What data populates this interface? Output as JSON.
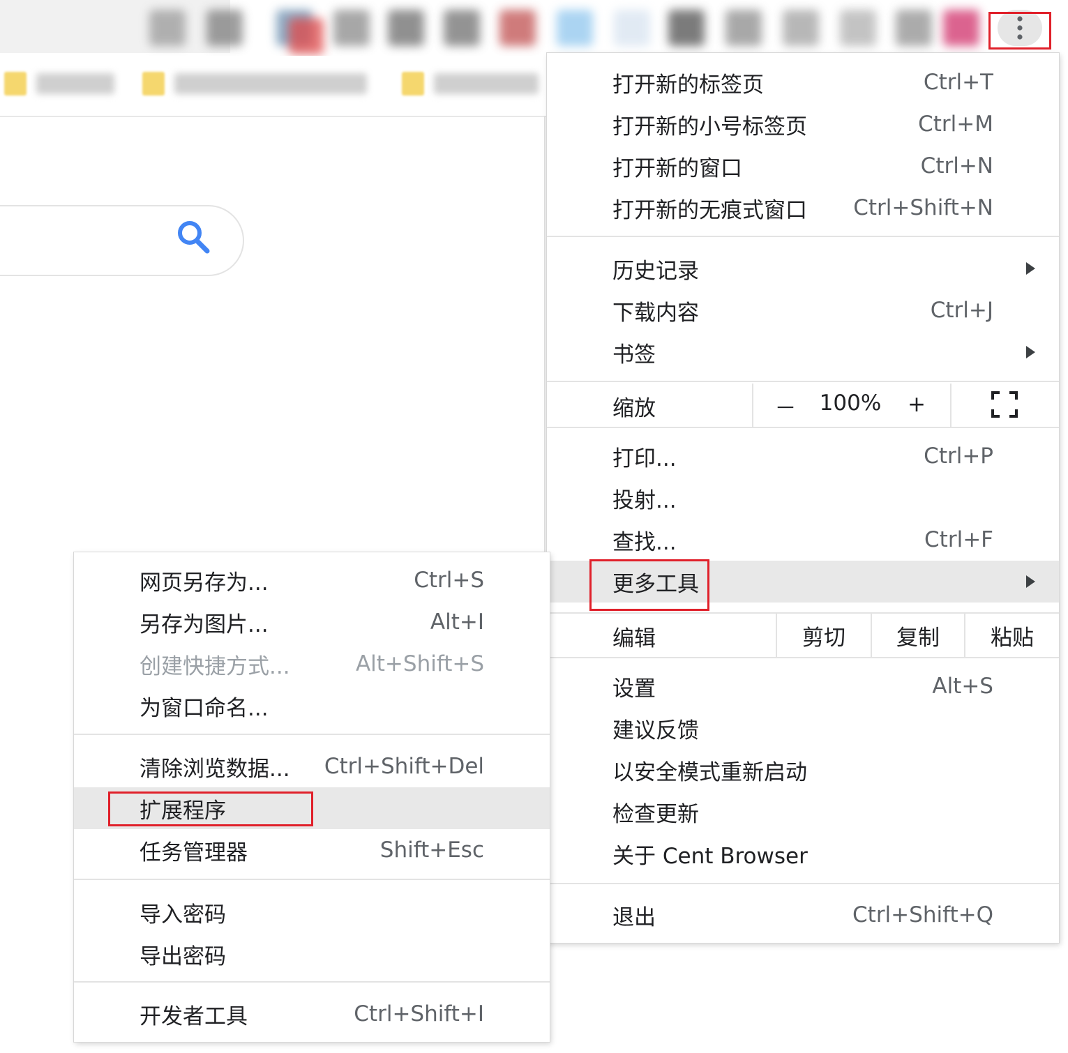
{
  "colors": {
    "highlight": "#e0202a",
    "menu_bg": "#ffffff",
    "selected_bg": "#e8e8e8",
    "search_icon": "#4285f4"
  },
  "toolbar": {
    "menu_icon": "three-dots-vertical-icon"
  },
  "search": {
    "icon": "search-icon"
  },
  "main_menu": {
    "new_tab": {
      "label": "打开新的标签页",
      "shortcut": "Ctrl+T"
    },
    "new_small_tab": {
      "label": "打开新的小号标签页",
      "shortcut": "Ctrl+M"
    },
    "new_window": {
      "label": "打开新的窗口",
      "shortcut": "Ctrl+N"
    },
    "new_incognito": {
      "label": "打开新的无痕式窗口",
      "shortcut": "Ctrl+Shift+N"
    },
    "history": {
      "label": "历史记录"
    },
    "downloads": {
      "label": "下载内容",
      "shortcut": "Ctrl+J"
    },
    "bookmarks": {
      "label": "书签"
    },
    "zoom": {
      "label": "缩放",
      "minus": "－",
      "value": "100%",
      "plus": "+",
      "fullscreen_icon": "fullscreen-icon"
    },
    "print": {
      "label": "打印...",
      "shortcut": "Ctrl+P"
    },
    "cast": {
      "label": "投射..."
    },
    "find": {
      "label": "查找...",
      "shortcut": "Ctrl+F"
    },
    "more_tools": {
      "label": "更多工具"
    },
    "edit": {
      "label": "编辑",
      "cut": "剪切",
      "copy": "复制",
      "paste": "粘贴"
    },
    "settings": {
      "label": "设置",
      "shortcut": "Alt+S"
    },
    "feedback": {
      "label": "建议反馈"
    },
    "safe_restart": {
      "label": "以安全模式重新启动"
    },
    "check_update": {
      "label": "检查更新"
    },
    "about": {
      "label": "关于 Cent Browser"
    },
    "exit": {
      "label": "退出",
      "shortcut": "Ctrl+Shift+Q"
    }
  },
  "more_tools_menu": {
    "save_page": {
      "label": "网页另存为...",
      "shortcut": "Ctrl+S"
    },
    "save_image": {
      "label": "另存为图片...",
      "shortcut": "Alt+I"
    },
    "create_shortcut": {
      "label": "创建快捷方式...",
      "shortcut": "Alt+Shift+S"
    },
    "name_window": {
      "label": "为窗口命名..."
    },
    "clear_data": {
      "label": "清除浏览数据...",
      "shortcut": "Ctrl+Shift+Del"
    },
    "extensions": {
      "label": "扩展程序"
    },
    "task_manager": {
      "label": "任务管理器",
      "shortcut": "Shift+Esc"
    },
    "import_passwords": {
      "label": "导入密码"
    },
    "export_passwords": {
      "label": "导出密码"
    },
    "dev_tools": {
      "label": "开发者工具",
      "shortcut": "Ctrl+Shift+I"
    }
  }
}
